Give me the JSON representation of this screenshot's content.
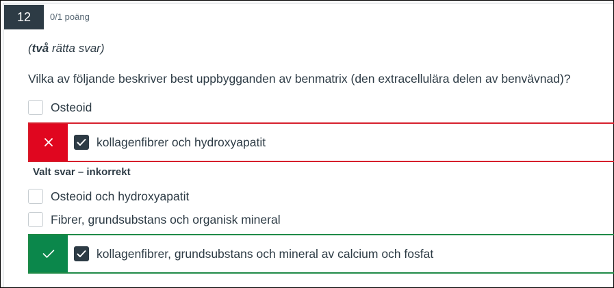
{
  "question": {
    "number": "12",
    "points": "0/1 poäng",
    "note_bold": "två",
    "note_prefix": "(",
    "note_suffix": " rätta svar)",
    "text": "Vilka av följande beskriver best uppbygganden av benmatrix (den extracellulära delen av benvävnad)?"
  },
  "options": [
    {
      "label": "Osteoid",
      "checked": false
    },
    {
      "label": "kollagenfibrer och hydroxyapatit",
      "checked": true,
      "state": "wrong"
    },
    {
      "label": "Osteoid och hydroxyapatit",
      "checked": false
    },
    {
      "label": "Fibrer, grundsubstans och organisk mineral",
      "checked": false
    },
    {
      "label": "kollagenfibrer, grundsubstans och mineral av calcium och fosfat",
      "checked": true,
      "state": "right"
    }
  ],
  "feedback": {
    "wrong_label": "Valt svar – inkorrekt"
  },
  "colors": {
    "wrong": "#e0061f",
    "right": "#0b874b",
    "dark": "#2d3b45"
  },
  "icons": {
    "wrong": "x-icon",
    "right": "checkmark-icon",
    "checkbox": "check-icon"
  }
}
